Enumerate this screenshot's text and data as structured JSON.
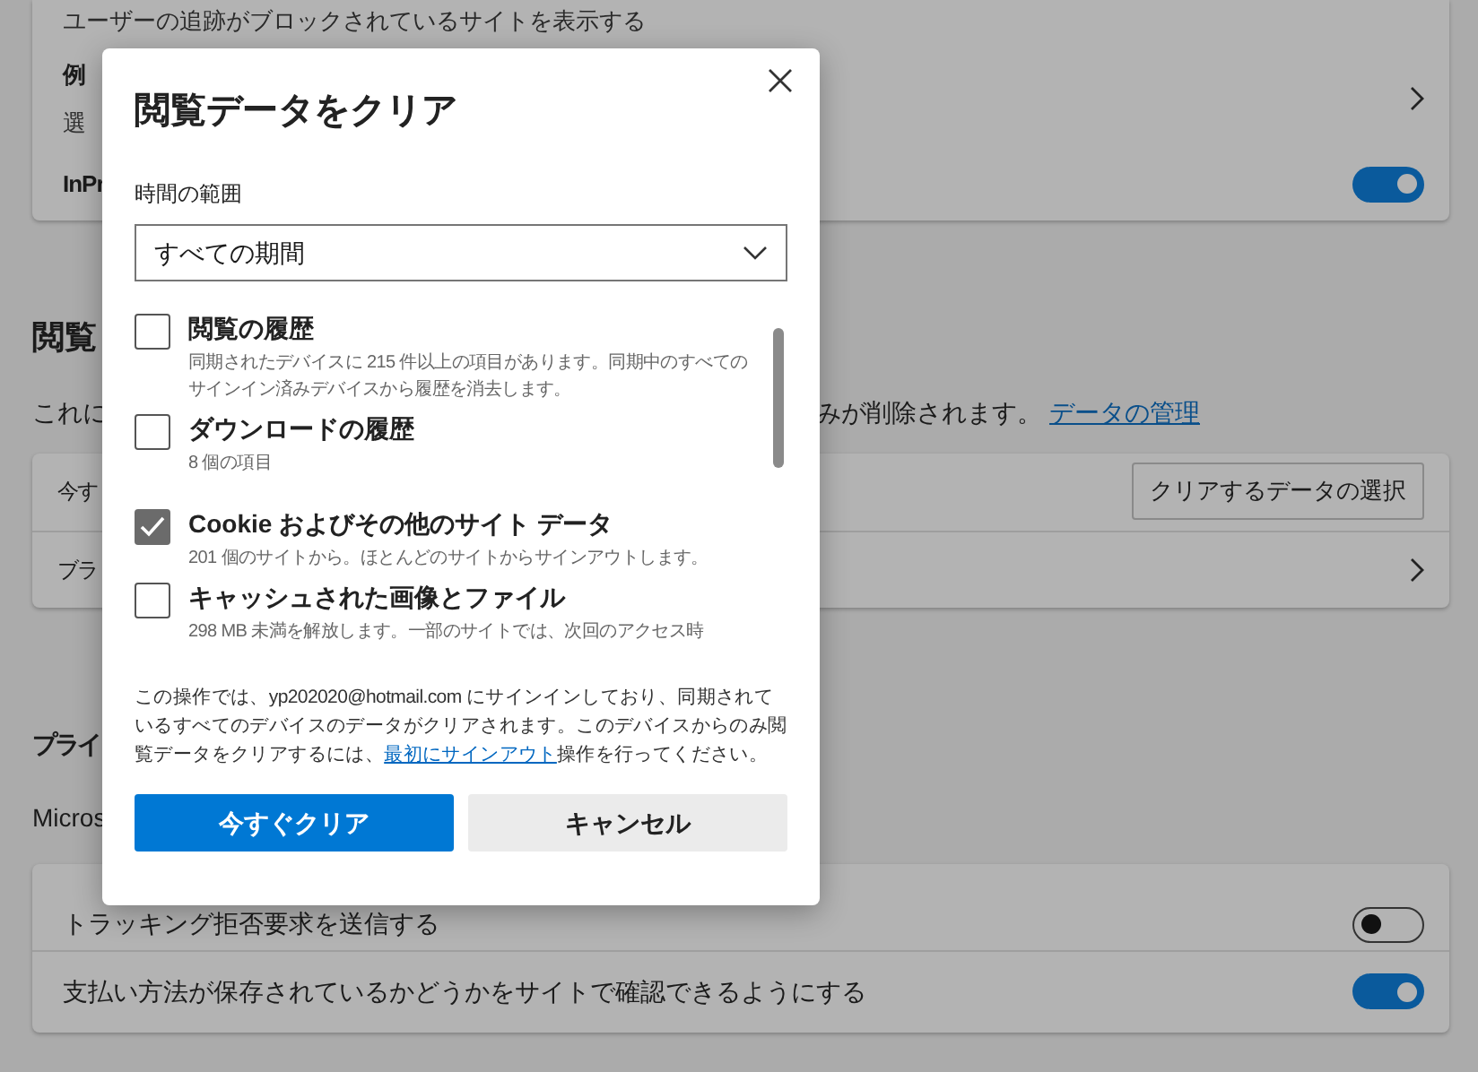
{
  "background": {
    "top_note": "ユーザーの追跡がブロックされているサイトを表示する",
    "card1_rows": [
      {
        "label": "例",
        "sub": "選",
        "kind": "link"
      },
      {
        "label": "InPr",
        "kind": "toggle",
        "on": true
      }
    ],
    "browsing_heading": "閲覧",
    "browsing_desc_left": "これに",
    "browsing_desc_right": "みが削除されます。",
    "manage_link": "データの管理",
    "card2_rows": [
      {
        "label": "今す",
        "kind": "button",
        "button": "クリアするデータの選択"
      },
      {
        "label": "ブラ",
        "kind": "link"
      }
    ],
    "privacy_heading": "プライ",
    "privacy_desc": "Micros",
    "privacy_rows": [
      {
        "label": "トラッキング拒否要求を送信する",
        "on": false
      },
      {
        "label": "支払い方法が保存されているかどうかをサイトで確認できるようにする",
        "on": true
      }
    ]
  },
  "dialog": {
    "title": "閲覧データをクリア",
    "range_label": "時間の範囲",
    "range_value": "すべての期間",
    "items": [
      {
        "label": "閲覧の履歴",
        "desc": "同期されたデバイスに 215 件以上の項目があります。同期中のすべてのサインイン済みデバイスから履歴を消去します。",
        "checked": false
      },
      {
        "label": "ダウンロードの履歴",
        "desc": "8 個の項目",
        "checked": false
      },
      {
        "label": "Cookie およびその他のサイト データ",
        "desc": "201 個のサイトから。ほとんどのサイトからサインアウトします。",
        "checked": true
      },
      {
        "label": "キャッシュされた画像とファイル",
        "desc": "298 MB 未満を解放します。一部のサイトでは、次回のアクセス時",
        "checked": false
      }
    ],
    "notice_before": "この操作では、yp202020@hotmail.com にサインインしており、同期されているすべてのデバイスのデータがクリアされます。このデバイスからのみ閲覧データをクリアするには、",
    "notice_link": "最初にサインアウト",
    "notice_after": "操作を行ってください。",
    "primary_button": "今すぐクリア",
    "cancel_button": "キャンセル"
  }
}
